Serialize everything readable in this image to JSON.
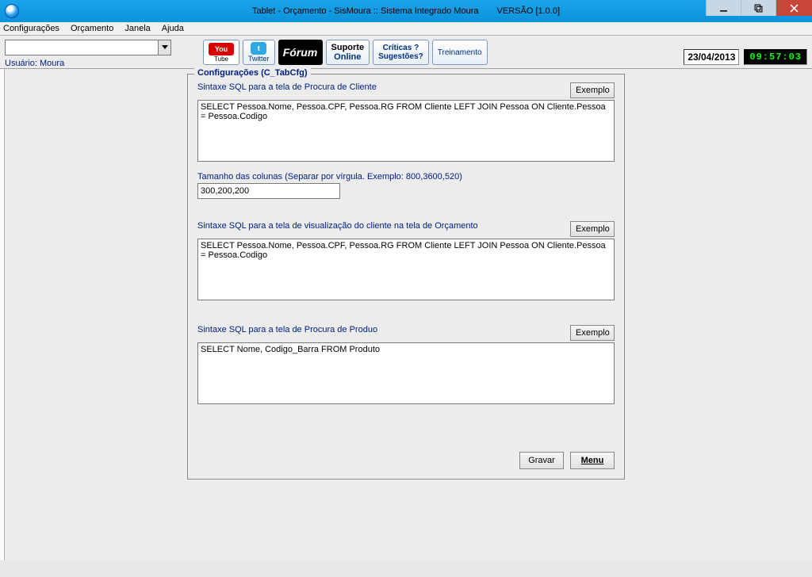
{
  "window": {
    "title_main": "Tablet - Orçamento - SisMoura :: Sistema Integrado Moura",
    "title_version": "VERSÃO [1.0.0]"
  },
  "menubar": {
    "items": [
      "Configurações",
      "Orçamento",
      "Janela",
      "Ajuda"
    ]
  },
  "toolbar": {
    "user_label": "Usuário: Moura",
    "youtube": "You",
    "twitter": "Twitter",
    "forum": "Fórum",
    "suporte_top": "Suporte",
    "suporte_bot": "Online",
    "criticas_top": "Críticas ?",
    "criticas_bot": "Sugestões?",
    "treinamento": "Treinamento",
    "date": "23/04/2013",
    "clock": "09:57:03"
  },
  "panel": {
    "legend": "Configurações (C_TabCfg)",
    "exemplo": "Exemplo",
    "sec1_label": "Sintaxe SQL para a tela de Procura de Cliente",
    "sec1_value": "SELECT Pessoa.Nome, Pessoa.CPF, Pessoa.RG FROM Cliente LEFT JOIN Pessoa ON Cliente.Pessoa = Pessoa.Codigo",
    "sec2_label": "Tamanho das colunas (Separar por vírgula. Exemplo: 800,3600,520)",
    "sec2_value": "300,200,200",
    "sec3_label": "Sintaxe SQL para a tela de visualização do cliente na tela de Orçamento",
    "sec3_value": "SELECT Pessoa.Nome, Pessoa.CPF, Pessoa.RG FROM Cliente LEFT JOIN Pessoa ON Cliente.Pessoa = Pessoa.Codigo",
    "sec4_label": "Sintaxe SQL para a tela de Procura de Produo",
    "sec4_value": "SELECT Nome, Codigo_Barra FROM Produto",
    "gravar": "Gravar",
    "menu": "Menu"
  }
}
